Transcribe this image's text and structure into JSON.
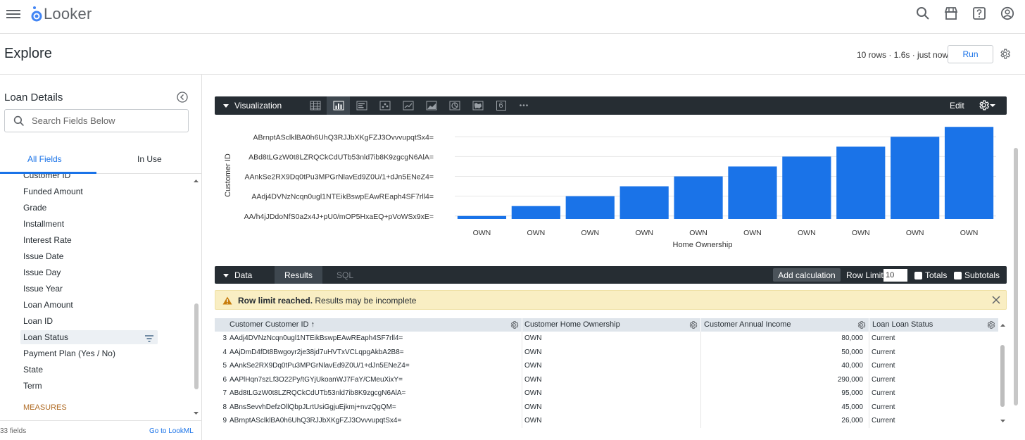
{
  "app": {
    "name": "Looker"
  },
  "page": {
    "title": "Explore",
    "run_info": "10 rows · 1.6s · just now",
    "run_label": "Run"
  },
  "sidebar": {
    "title": "Loan Details",
    "search_placeholder": "Search Fields Below",
    "tabs": [
      "All Fields",
      "In Use"
    ],
    "fields": [
      "Customer ID",
      "Funded Amount",
      "Grade",
      "Installment",
      "Interest Rate",
      "Issue Date",
      "Issue Day",
      "Issue Year",
      "Loan Amount",
      "Loan ID",
      "Loan Status",
      "Payment Plan (Yes / No)",
      "State",
      "Term"
    ],
    "measures_label": "MEASURES",
    "field_count": "33 fields",
    "lookml_link": "Go to LookML"
  },
  "viz": {
    "label": "Visualization",
    "edit_label": "Edit",
    "icons": [
      "table-icon",
      "column-chart-icon",
      "bar-chart-icon",
      "scatter-icon",
      "line-chart-icon",
      "area-chart-icon",
      "pie-chart-icon",
      "map-icon",
      "single-value-icon",
      "more-icon"
    ],
    "single_value_glyph": "6",
    "more_glyph": "•••"
  },
  "chart_data": {
    "type": "bar",
    "xlabel": "Home Ownership",
    "ylabel": "Customer ID",
    "categories": [
      "OWN",
      "OWN",
      "OWN",
      "OWN",
      "OWN",
      "OWN",
      "OWN",
      "OWN",
      "OWN",
      "OWN"
    ],
    "values": [
      0,
      1,
      2,
      3,
      4,
      5,
      6,
      7,
      8,
      9
    ],
    "y_ticks": [
      {
        "value": 0,
        "label": "AA/h4jJDdoNfS0a2x4J+pU0/mOP5HxaEQ+pVoWSx9xE="
      },
      {
        "value": 2,
        "label": "AAdj4DVNzNcqn0ugl1NTEikBswpEAwREaph4SF7rll4="
      },
      {
        "value": 4,
        "label": "AAnkSe2RX9Dq0tPu3MPGrNlavEd9Z0U/1+dJn5ENeZ4="
      },
      {
        "value": 6,
        "label": "ABd8tLGzW0t8LZRQCkCdUTb53nld7ib8K9zgcgN6AlA="
      },
      {
        "value": 8,
        "label": "ABrnptASclklBA0h6UhQ3RJJbXKgFZJ3OvvvupqtSx4="
      }
    ],
    "ylim": [
      -0.3,
      9.3
    ],
    "color": "#1a73e8"
  },
  "data_panel": {
    "label": "Data",
    "results_tab": "Results",
    "sql_tab": "SQL",
    "add_calc": "Add calculation",
    "row_limit_label": "Row Limit",
    "row_limit_value": "10",
    "totals_label": "Totals",
    "subtotals_label": "Subtotals"
  },
  "warning": {
    "bold": "Row limit reached.",
    "text": " Results may be incomplete"
  },
  "table": {
    "columns": [
      {
        "prefix": "Customer ",
        "name": "Customer ID ↑"
      },
      {
        "prefix": "Customer ",
        "name": "Home Ownership"
      },
      {
        "prefix": "Customer ",
        "name": "Annual Income"
      },
      {
        "prefix": "Loan ",
        "name": "Loan Status"
      }
    ],
    "rows": [
      {
        "n": "3",
        "id": "AAdj4DVNzNcqn0ugl1NTEikBswpEAwREaph4SF7rll4=",
        "home": "OWN",
        "income": "80,000",
        "status": "Current"
      },
      {
        "n": "4",
        "id": "AAjDmD4fDt8Bwgoyr2je38jd7uHVTxVCLqpgAkbA2B8=",
        "home": "OWN",
        "income": "50,000",
        "status": "Current"
      },
      {
        "n": "5",
        "id": "AAnkSe2RX9Dq0tPu3MPGrNlavEd9Z0U/1+dJn5ENeZ4=",
        "home": "OWN",
        "income": "40,000",
        "status": "Current"
      },
      {
        "n": "6",
        "id": "AAPlHqn7szLf3O22Py/tGYjUkoanWJ7FaY/CMeuXixY=",
        "home": "OWN",
        "income": "290,000",
        "status": "Current"
      },
      {
        "n": "7",
        "id": "ABd8tLGzW0t8LZRQCkCdUTb53nld7ib8K9zgcgN6AlA=",
        "home": "OWN",
        "income": "95,000",
        "status": "Current"
      },
      {
        "n": "8",
        "id": "ABnsSevvhDefzOllQbpJLrtUsiGgjuEjkmj+nvzQgQM=",
        "home": "OWN",
        "income": "45,000",
        "status": "Current"
      },
      {
        "n": "9",
        "id": "ABrnptASclklBA0h6UhQ3RJJbXKgFZJ3OvvvupqtSx4=",
        "home": "OWN",
        "income": "26,000",
        "status": "Current"
      }
    ]
  }
}
